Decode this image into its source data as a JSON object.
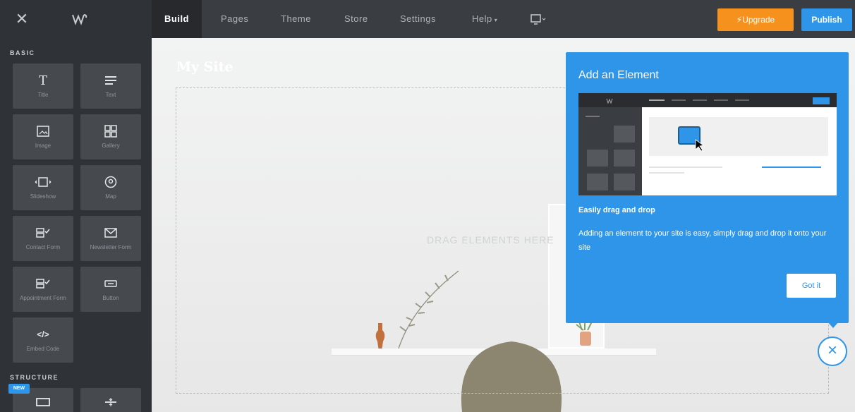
{
  "topbar": {
    "nav": [
      "Build",
      "Pages",
      "Theme",
      "Store",
      "Settings",
      "Help"
    ],
    "upgrade_label": "Upgrade",
    "publish_label": "Publish"
  },
  "sidebar": {
    "basic_label": "BASIC",
    "structure_label": "STRUCTURE",
    "new_badge": "NEW",
    "elements": [
      {
        "label": "Title",
        "icon": "title-icon"
      },
      {
        "label": "Text",
        "icon": "text-icon"
      },
      {
        "label": "Image",
        "icon": "image-icon"
      },
      {
        "label": "Gallery",
        "icon": "gallery-icon"
      },
      {
        "label": "Slideshow",
        "icon": "slideshow-icon"
      },
      {
        "label": "Map",
        "icon": "map-icon"
      },
      {
        "label": "Contact Form",
        "icon": "contact-form-icon"
      },
      {
        "label": "Newsletter Form",
        "icon": "newsletter-form-icon"
      },
      {
        "label": "Appointment Form",
        "icon": "appointment-form-icon"
      },
      {
        "label": "Button",
        "icon": "button-icon"
      },
      {
        "label": "Embed Code",
        "icon": "embed-code-icon"
      }
    ]
  },
  "canvas": {
    "site_title": "My Site",
    "drop_hint": "DRAG ELEMENTS HERE"
  },
  "panel": {
    "title": "Add an Element",
    "subtitle": "Easily drag and drop",
    "body": "Adding an element to your site is easy, simply drag and drop it onto your site",
    "button": "Got it"
  },
  "colors": {
    "accent": "#2f95e8",
    "upgrade": "#f7911e",
    "dark": "#2f3236"
  }
}
